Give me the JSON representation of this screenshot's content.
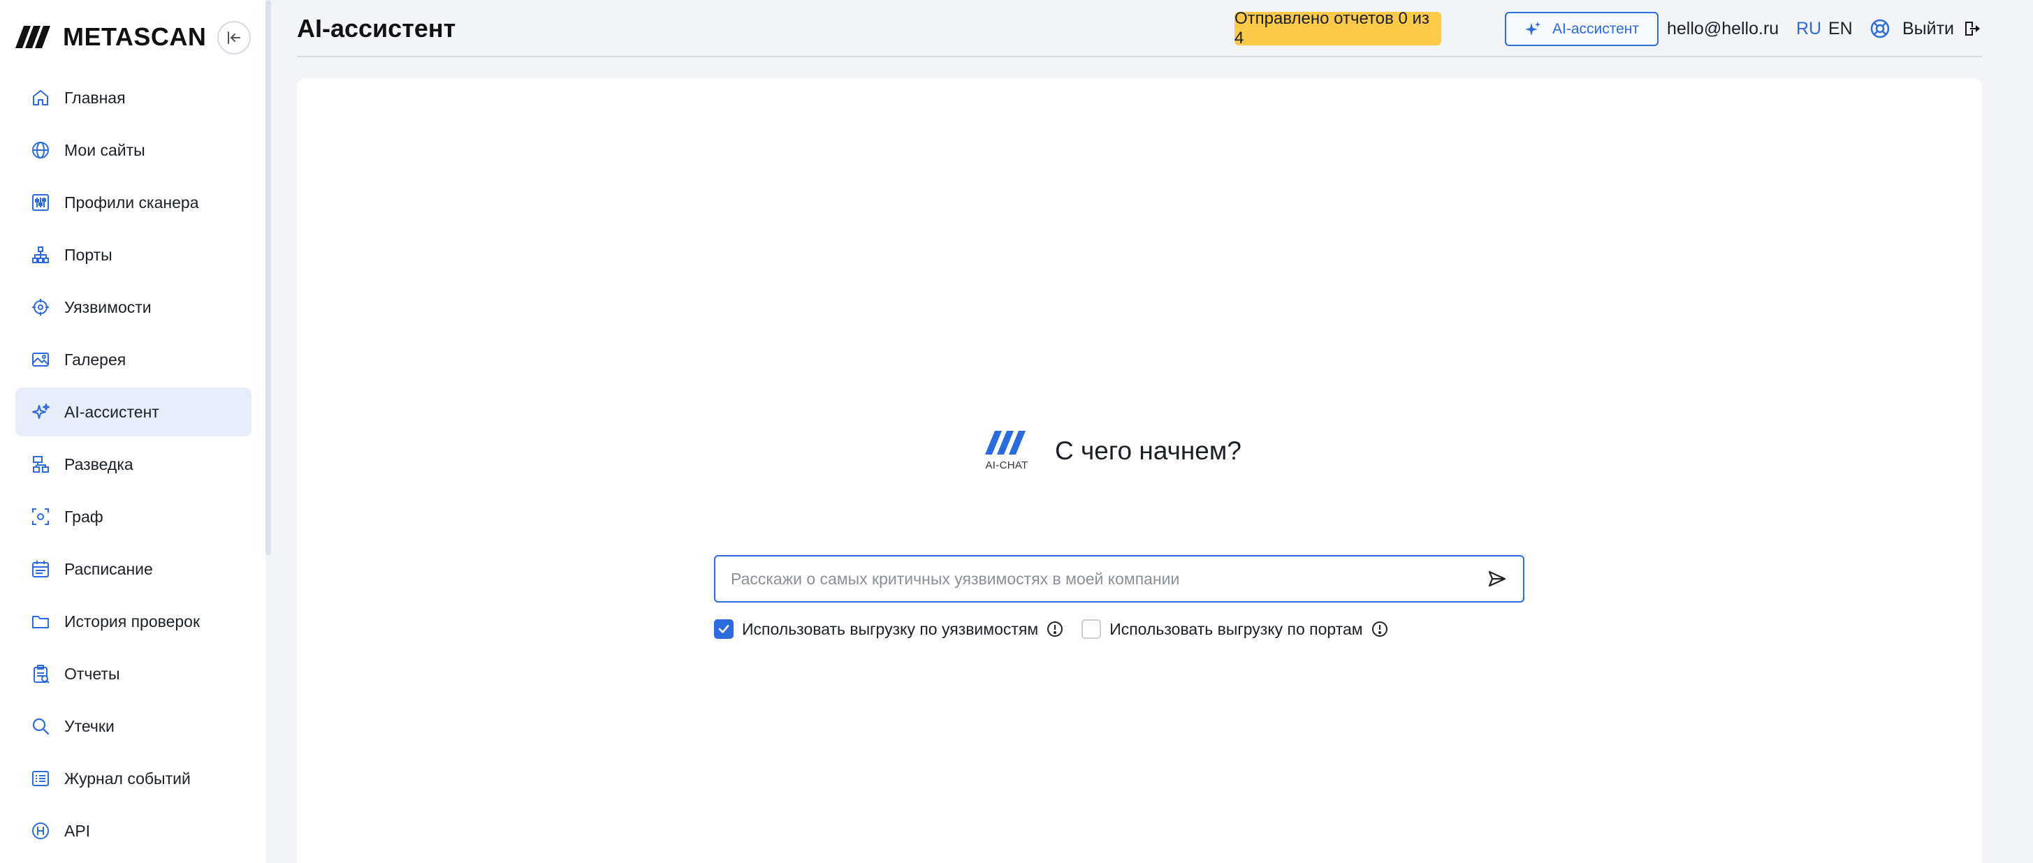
{
  "app": {
    "logo_text": "METASCAN"
  },
  "sidebar": {
    "items": [
      {
        "label": "Главная",
        "icon": "home-icon"
      },
      {
        "label": "Мои сайты",
        "icon": "globe-icon"
      },
      {
        "label": "Профили сканера",
        "icon": "sliders-icon"
      },
      {
        "label": "Порты",
        "icon": "network-icon"
      },
      {
        "label": "Уязвимости",
        "icon": "crosshair-icon"
      },
      {
        "label": "Галерея",
        "icon": "image-icon"
      },
      {
        "label": "AI-ассистент",
        "icon": "sparkle-icon",
        "active": true
      },
      {
        "label": "Разведка",
        "icon": "sitemap-icon"
      },
      {
        "label": "Граф",
        "icon": "graph-icon"
      },
      {
        "label": "Расписание",
        "icon": "calendar-icon"
      },
      {
        "label": "История проверок",
        "icon": "folder-icon"
      },
      {
        "label": "Отчеты",
        "icon": "clipboard-icon"
      },
      {
        "label": "Утечки",
        "icon": "search-icon"
      },
      {
        "label": "Журнал событий",
        "icon": "list-icon"
      },
      {
        "label": "API",
        "icon": "api-icon"
      }
    ]
  },
  "header": {
    "title": "AI-ассистент",
    "reports_badge": "Отправлено отчетов 0 из 4",
    "ai_button": "AI-ассистент",
    "user_email": "hello@hello.ru",
    "lang_ru": "RU",
    "lang_en": "EN",
    "logout_label": "Выйти"
  },
  "main": {
    "ai_logo_caption": "AI-CHAT",
    "hero_title": "С чего начнем?",
    "chat_placeholder": "Расскажи о самых критичных уязвимостях в моей компании",
    "chat_value": "",
    "options": [
      {
        "label": "Использовать выгрузку по уязвимостям",
        "checked": true
      },
      {
        "label": "Использовать выгрузку по портам",
        "checked": false
      }
    ]
  },
  "colors": {
    "accent": "#2c6bdc",
    "badge": "#ffc94a",
    "active_nav": "#e7eef9"
  }
}
